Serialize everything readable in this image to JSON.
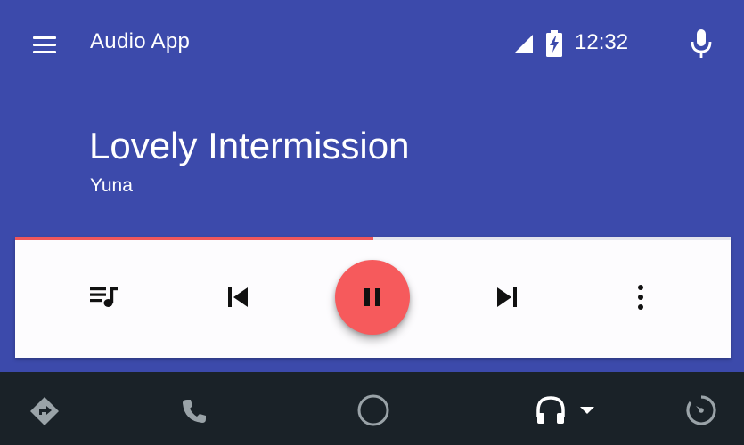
{
  "header": {
    "app_title": "Audio App",
    "time": "12:32",
    "icons": [
      "menu-icon",
      "signal-icon",
      "battery-charging-icon",
      "mic-icon"
    ]
  },
  "now_playing": {
    "title": "Lovely Intermission",
    "artist": "Yuna",
    "progress": 0.5
  },
  "controls": [
    "queue-music-icon",
    "skip-previous-icon",
    "pause-icon",
    "skip-next-icon",
    "more-vert-icon"
  ],
  "navbar": [
    "navigation-icon",
    "phone-icon",
    "home-circle-icon",
    "headphones-icon",
    "overview-icon"
  ],
  "colors": {
    "primary": "#3c4aab",
    "accent": "#f65a5c",
    "card": "#fdfcfe",
    "navbar": "#1a2228",
    "nav_icon": "#9aa3a8"
  }
}
